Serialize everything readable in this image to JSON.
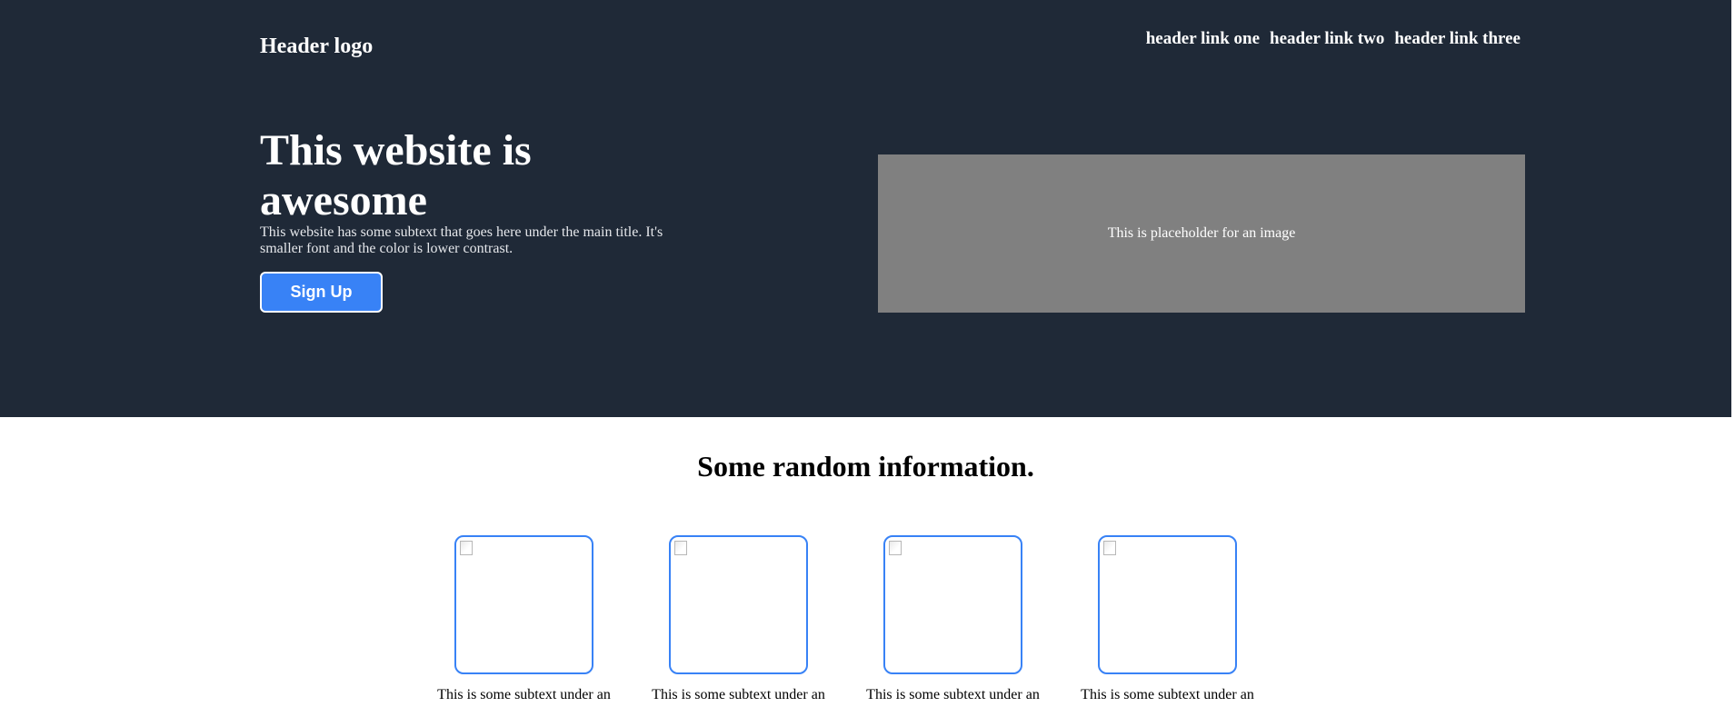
{
  "header": {
    "logo": "Header logo",
    "links": [
      "header link one",
      "header link two",
      "header link three"
    ]
  },
  "hero": {
    "title": "This website is awesome",
    "subtext": "This website has some subtext that goes here under the main title. It's smaller font and the color is lower contrast.",
    "signup_label": "Sign Up",
    "image_placeholder": "This is placeholder for an image"
  },
  "info": {
    "title": "Some random information.",
    "cards": [
      {
        "text": "This is some subtext under an"
      },
      {
        "text": "This is some subtext under an"
      },
      {
        "text": "This is some subtext under an"
      },
      {
        "text": "This is some subtext under an"
      }
    ]
  },
  "colors": {
    "hero_background": "#1f2937",
    "accent": "#3882f6",
    "placeholder_background": "#808080"
  },
  "icons": {
    "card_image": "broken-image-icon"
  }
}
